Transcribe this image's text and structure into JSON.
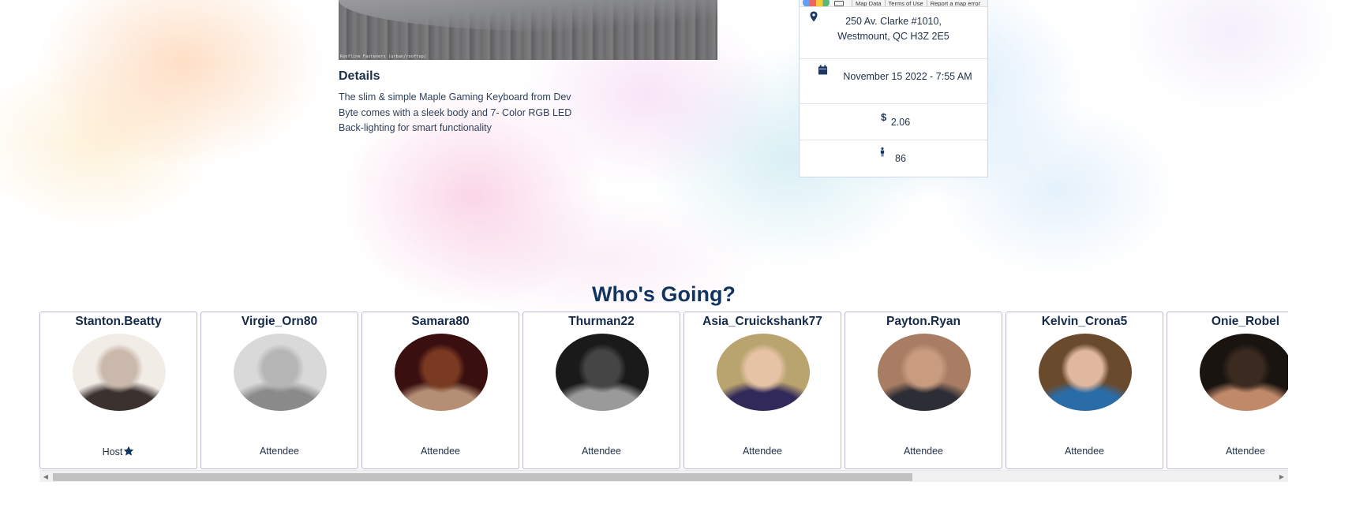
{
  "hero": {
    "caption": "Roofline Fasteners (urban/rooftop)"
  },
  "details": {
    "heading": "Details",
    "description": "The slim & simple Maple Gaming Keyboard from Dev Byte comes with a sleek body and 7- Color RGB LED Back-lighting for smart functionality"
  },
  "info": {
    "map_links": [
      "Map Data",
      "Terms of Use",
      "Report a map error"
    ],
    "address_line1": "250 Av. Clarke #1010,",
    "address_line2": "Westmount, QC H3Z 2E5",
    "datetime": "November 15 2022 - 7:55 AM",
    "price": "2.06",
    "attendee_count": "86",
    "icons": {
      "address": "map-pin-icon",
      "date": "calendar-icon",
      "price": "dollar-icon",
      "count": "person-icon"
    },
    "accent": "#1c3766"
  },
  "whos_going": {
    "title": "Who's Going?",
    "people": [
      {
        "username": "Stanton.Beatty",
        "role": "Host",
        "is_host": true,
        "avatar_tones": [
          "#f2ece6",
          "#3b3230",
          "#c9b8ab"
        ]
      },
      {
        "username": "Virgie_Orn80",
        "role": "Attendee",
        "is_host": false,
        "avatar_tones": [
          "#d9d9d9",
          "#8a8a8a",
          "#b5b5b5"
        ]
      },
      {
        "username": "Samara80",
        "role": "Attendee",
        "is_host": false,
        "avatar_tones": [
          "#3a0f10",
          "#b48f74",
          "#7a3a22"
        ]
      },
      {
        "username": "Thurman22",
        "role": "Attendee",
        "is_host": false,
        "avatar_tones": [
          "#1a1a1a",
          "#9a9a9a",
          "#454545"
        ]
      },
      {
        "username": "Asia_Cruickshank77",
        "role": "Attendee",
        "is_host": false,
        "avatar_tones": [
          "#b9a36f",
          "#31295a",
          "#e6c3a5"
        ]
      },
      {
        "username": "Payton.Ryan",
        "role": "Attendee",
        "is_host": false,
        "avatar_tones": [
          "#a87d63",
          "#2c2d35",
          "#c99c80"
        ]
      },
      {
        "username": "Kelvin_Crona5",
        "role": "Attendee",
        "is_host": false,
        "avatar_tones": [
          "#6a4a2c",
          "#2a6ca8",
          "#e0b8a0"
        ]
      },
      {
        "username": "Onie_Robel",
        "role": "Attendee",
        "is_host": false,
        "avatar_tones": [
          "#1a1410",
          "#c08a6a",
          "#3a2a20"
        ]
      }
    ]
  },
  "colors": {
    "title": "#12355f",
    "card_border": "#b9b6e0",
    "text": "#15294a"
  }
}
